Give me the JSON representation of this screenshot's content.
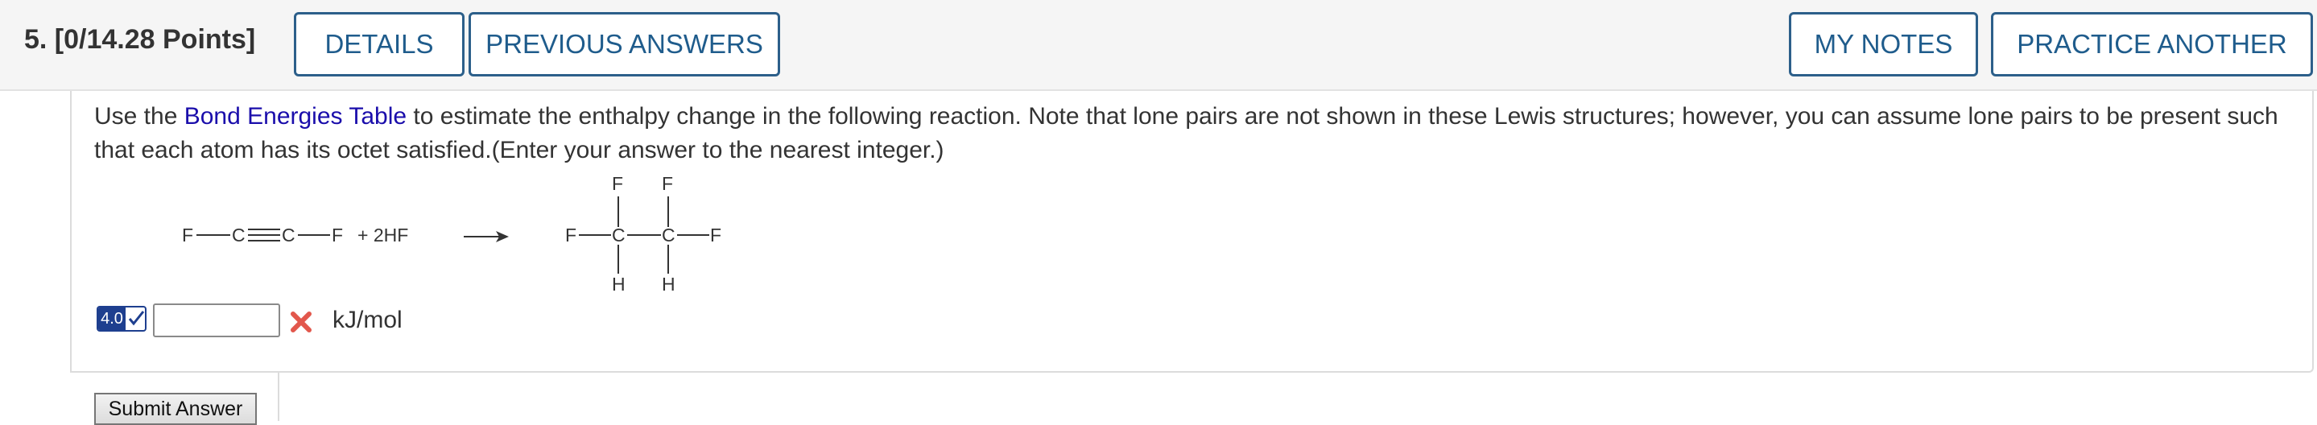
{
  "question": {
    "number_label": "5.  [0/14.28 Points]"
  },
  "toolbar": {
    "details_label": "DETAILS",
    "previous_answers_label": "PREVIOUS ANSWERS",
    "my_notes_label": "MY NOTES",
    "practice_another_label": "PRACTICE ANOTHER"
  },
  "prompt": {
    "prefix": "Use the ",
    "link_text": "Bond Energies Table",
    "suffix": " to estimate the enthalpy change in the following reaction. Note that lone pairs are not shown in these Lewis structures; however, you can assume lone pairs to be present such that each atom has its octet satisfied.(Enter your answer to the nearest integer.)"
  },
  "reaction": {
    "reactant": {
      "atoms": [
        "F",
        "C",
        "C",
        "F"
      ],
      "bond_C_C": "triple",
      "coreactant": "+ 2HF"
    },
    "product": {
      "top_atoms": [
        "F",
        "F"
      ],
      "chain_atoms": [
        "F",
        "C",
        "C",
        "F"
      ],
      "bottom_atoms": [
        "H",
        "H"
      ]
    }
  },
  "answer": {
    "badge_value": "4.0",
    "badge_status": "checked",
    "input_value": "",
    "result": "incorrect",
    "unit": "kJ/mol"
  },
  "submit": {
    "label": "Submit Answer"
  },
  "colors": {
    "button_border": "#2c5f8a",
    "button_text": "#1f5c8c",
    "link": "#1a0dab",
    "incorrect": "#e2574c",
    "badge": "#1e3f8f"
  }
}
